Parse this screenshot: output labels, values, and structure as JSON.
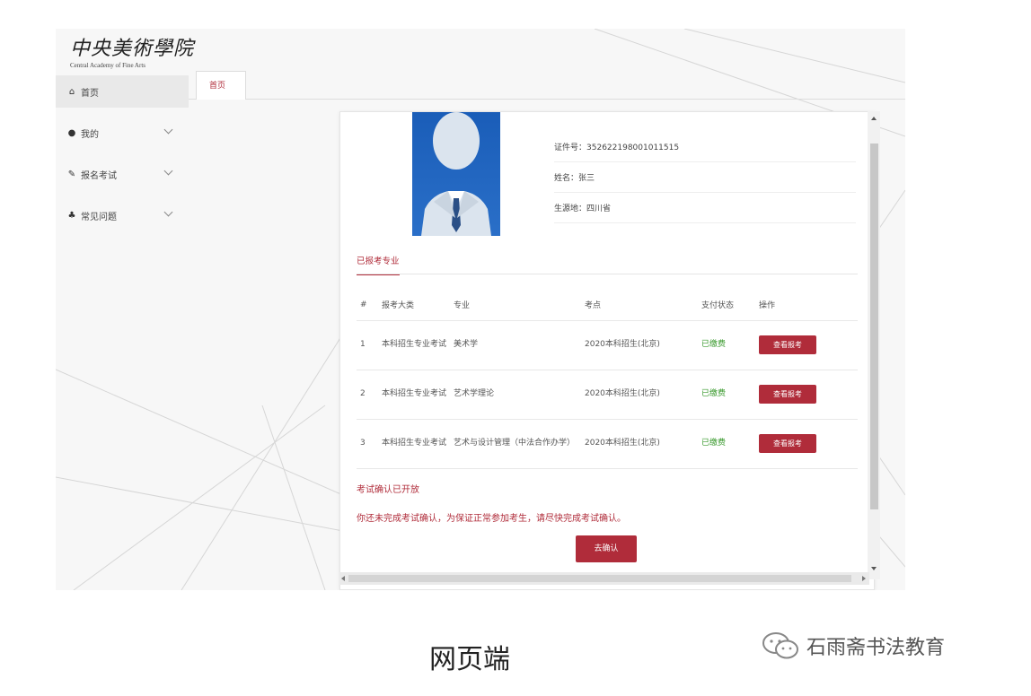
{
  "logo": {
    "cn": "中央美術學院",
    "en": "Central Academy of Fine Arts"
  },
  "sidebar": {
    "items": [
      {
        "label": "首页",
        "icon": "home-icon"
      },
      {
        "label": "我的",
        "icon": "user-icon"
      },
      {
        "label": "报名考试",
        "icon": "edit-icon"
      },
      {
        "label": "常见问题",
        "icon": "sitemap-icon"
      }
    ]
  },
  "tabs": {
    "home": "首页"
  },
  "profile": {
    "id_label": "证件号：",
    "id_value": "352622198001011515",
    "name_label": "姓名：",
    "name_value": "张三",
    "origin_label": "生源地：",
    "origin_value": "四川省"
  },
  "section": {
    "title": "已报考专业"
  },
  "table": {
    "headers": [
      "#",
      "报考大类",
      "专业",
      "考点",
      "支付状态",
      "操作"
    ],
    "rows": [
      {
        "no": "1",
        "category": "本科招生专业考试",
        "major": "美术学",
        "site": "2020本科招生(北京)",
        "status": "已缴费",
        "action": "查看报考"
      },
      {
        "no": "2",
        "category": "本科招生专业考试",
        "major": "艺术学理论",
        "site": "2020本科招生(北京)",
        "status": "已缴费",
        "action": "查看报考"
      },
      {
        "no": "3",
        "category": "本科招生专业考试",
        "major": "艺术与设计管理（中法合作办学）",
        "site": "2020本科招生(北京)",
        "status": "已缴费",
        "action": "查看报考"
      }
    ]
  },
  "notice": {
    "title": "考试确认已开放",
    "text": "你还未完成考试确认，为保证正常参加考生，请尽快完成考试确认。",
    "button": "去确认"
  },
  "caption": "网页端",
  "watermark": "石雨斋书法教育",
  "colors": {
    "accent": "#b02c3a",
    "paid": "#3a9a2e",
    "photo_bg": "#1a5db8"
  }
}
